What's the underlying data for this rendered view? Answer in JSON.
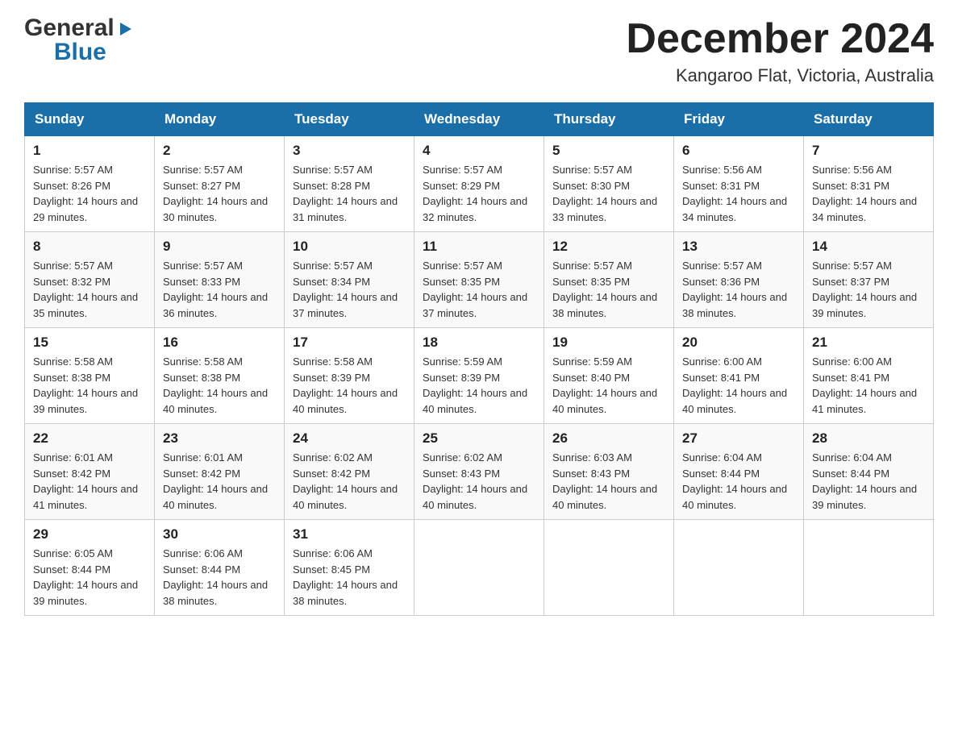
{
  "header": {
    "logo_general": "General",
    "logo_blue": "Blue",
    "month_title": "December 2024",
    "location": "Kangaroo Flat, Victoria, Australia"
  },
  "days_of_week": [
    "Sunday",
    "Monday",
    "Tuesday",
    "Wednesday",
    "Thursday",
    "Friday",
    "Saturday"
  ],
  "weeks": [
    [
      {
        "day": "1",
        "sunrise": "5:57 AM",
        "sunset": "8:26 PM",
        "daylight": "14 hours and 29 minutes."
      },
      {
        "day": "2",
        "sunrise": "5:57 AM",
        "sunset": "8:27 PM",
        "daylight": "14 hours and 30 minutes."
      },
      {
        "day": "3",
        "sunrise": "5:57 AM",
        "sunset": "8:28 PM",
        "daylight": "14 hours and 31 minutes."
      },
      {
        "day": "4",
        "sunrise": "5:57 AM",
        "sunset": "8:29 PM",
        "daylight": "14 hours and 32 minutes."
      },
      {
        "day": "5",
        "sunrise": "5:57 AM",
        "sunset": "8:30 PM",
        "daylight": "14 hours and 33 minutes."
      },
      {
        "day": "6",
        "sunrise": "5:56 AM",
        "sunset": "8:31 PM",
        "daylight": "14 hours and 34 minutes."
      },
      {
        "day": "7",
        "sunrise": "5:56 AM",
        "sunset": "8:31 PM",
        "daylight": "14 hours and 34 minutes."
      }
    ],
    [
      {
        "day": "8",
        "sunrise": "5:57 AM",
        "sunset": "8:32 PM",
        "daylight": "14 hours and 35 minutes."
      },
      {
        "day": "9",
        "sunrise": "5:57 AM",
        "sunset": "8:33 PM",
        "daylight": "14 hours and 36 minutes."
      },
      {
        "day": "10",
        "sunrise": "5:57 AM",
        "sunset": "8:34 PM",
        "daylight": "14 hours and 37 minutes."
      },
      {
        "day": "11",
        "sunrise": "5:57 AM",
        "sunset": "8:35 PM",
        "daylight": "14 hours and 37 minutes."
      },
      {
        "day": "12",
        "sunrise": "5:57 AM",
        "sunset": "8:35 PM",
        "daylight": "14 hours and 38 minutes."
      },
      {
        "day": "13",
        "sunrise": "5:57 AM",
        "sunset": "8:36 PM",
        "daylight": "14 hours and 38 minutes."
      },
      {
        "day": "14",
        "sunrise": "5:57 AM",
        "sunset": "8:37 PM",
        "daylight": "14 hours and 39 minutes."
      }
    ],
    [
      {
        "day": "15",
        "sunrise": "5:58 AM",
        "sunset": "8:38 PM",
        "daylight": "14 hours and 39 minutes."
      },
      {
        "day": "16",
        "sunrise": "5:58 AM",
        "sunset": "8:38 PM",
        "daylight": "14 hours and 40 minutes."
      },
      {
        "day": "17",
        "sunrise": "5:58 AM",
        "sunset": "8:39 PM",
        "daylight": "14 hours and 40 minutes."
      },
      {
        "day": "18",
        "sunrise": "5:59 AM",
        "sunset": "8:39 PM",
        "daylight": "14 hours and 40 minutes."
      },
      {
        "day": "19",
        "sunrise": "5:59 AM",
        "sunset": "8:40 PM",
        "daylight": "14 hours and 40 minutes."
      },
      {
        "day": "20",
        "sunrise": "6:00 AM",
        "sunset": "8:41 PM",
        "daylight": "14 hours and 40 minutes."
      },
      {
        "day": "21",
        "sunrise": "6:00 AM",
        "sunset": "8:41 PM",
        "daylight": "14 hours and 41 minutes."
      }
    ],
    [
      {
        "day": "22",
        "sunrise": "6:01 AM",
        "sunset": "8:42 PM",
        "daylight": "14 hours and 41 minutes."
      },
      {
        "day": "23",
        "sunrise": "6:01 AM",
        "sunset": "8:42 PM",
        "daylight": "14 hours and 40 minutes."
      },
      {
        "day": "24",
        "sunrise": "6:02 AM",
        "sunset": "8:42 PM",
        "daylight": "14 hours and 40 minutes."
      },
      {
        "day": "25",
        "sunrise": "6:02 AM",
        "sunset": "8:43 PM",
        "daylight": "14 hours and 40 minutes."
      },
      {
        "day": "26",
        "sunrise": "6:03 AM",
        "sunset": "8:43 PM",
        "daylight": "14 hours and 40 minutes."
      },
      {
        "day": "27",
        "sunrise": "6:04 AM",
        "sunset": "8:44 PM",
        "daylight": "14 hours and 40 minutes."
      },
      {
        "day": "28",
        "sunrise": "6:04 AM",
        "sunset": "8:44 PM",
        "daylight": "14 hours and 39 minutes."
      }
    ],
    [
      {
        "day": "29",
        "sunrise": "6:05 AM",
        "sunset": "8:44 PM",
        "daylight": "14 hours and 39 minutes."
      },
      {
        "day": "30",
        "sunrise": "6:06 AM",
        "sunset": "8:44 PM",
        "daylight": "14 hours and 38 minutes."
      },
      {
        "day": "31",
        "sunrise": "6:06 AM",
        "sunset": "8:45 PM",
        "daylight": "14 hours and 38 minutes."
      },
      null,
      null,
      null,
      null
    ]
  ]
}
